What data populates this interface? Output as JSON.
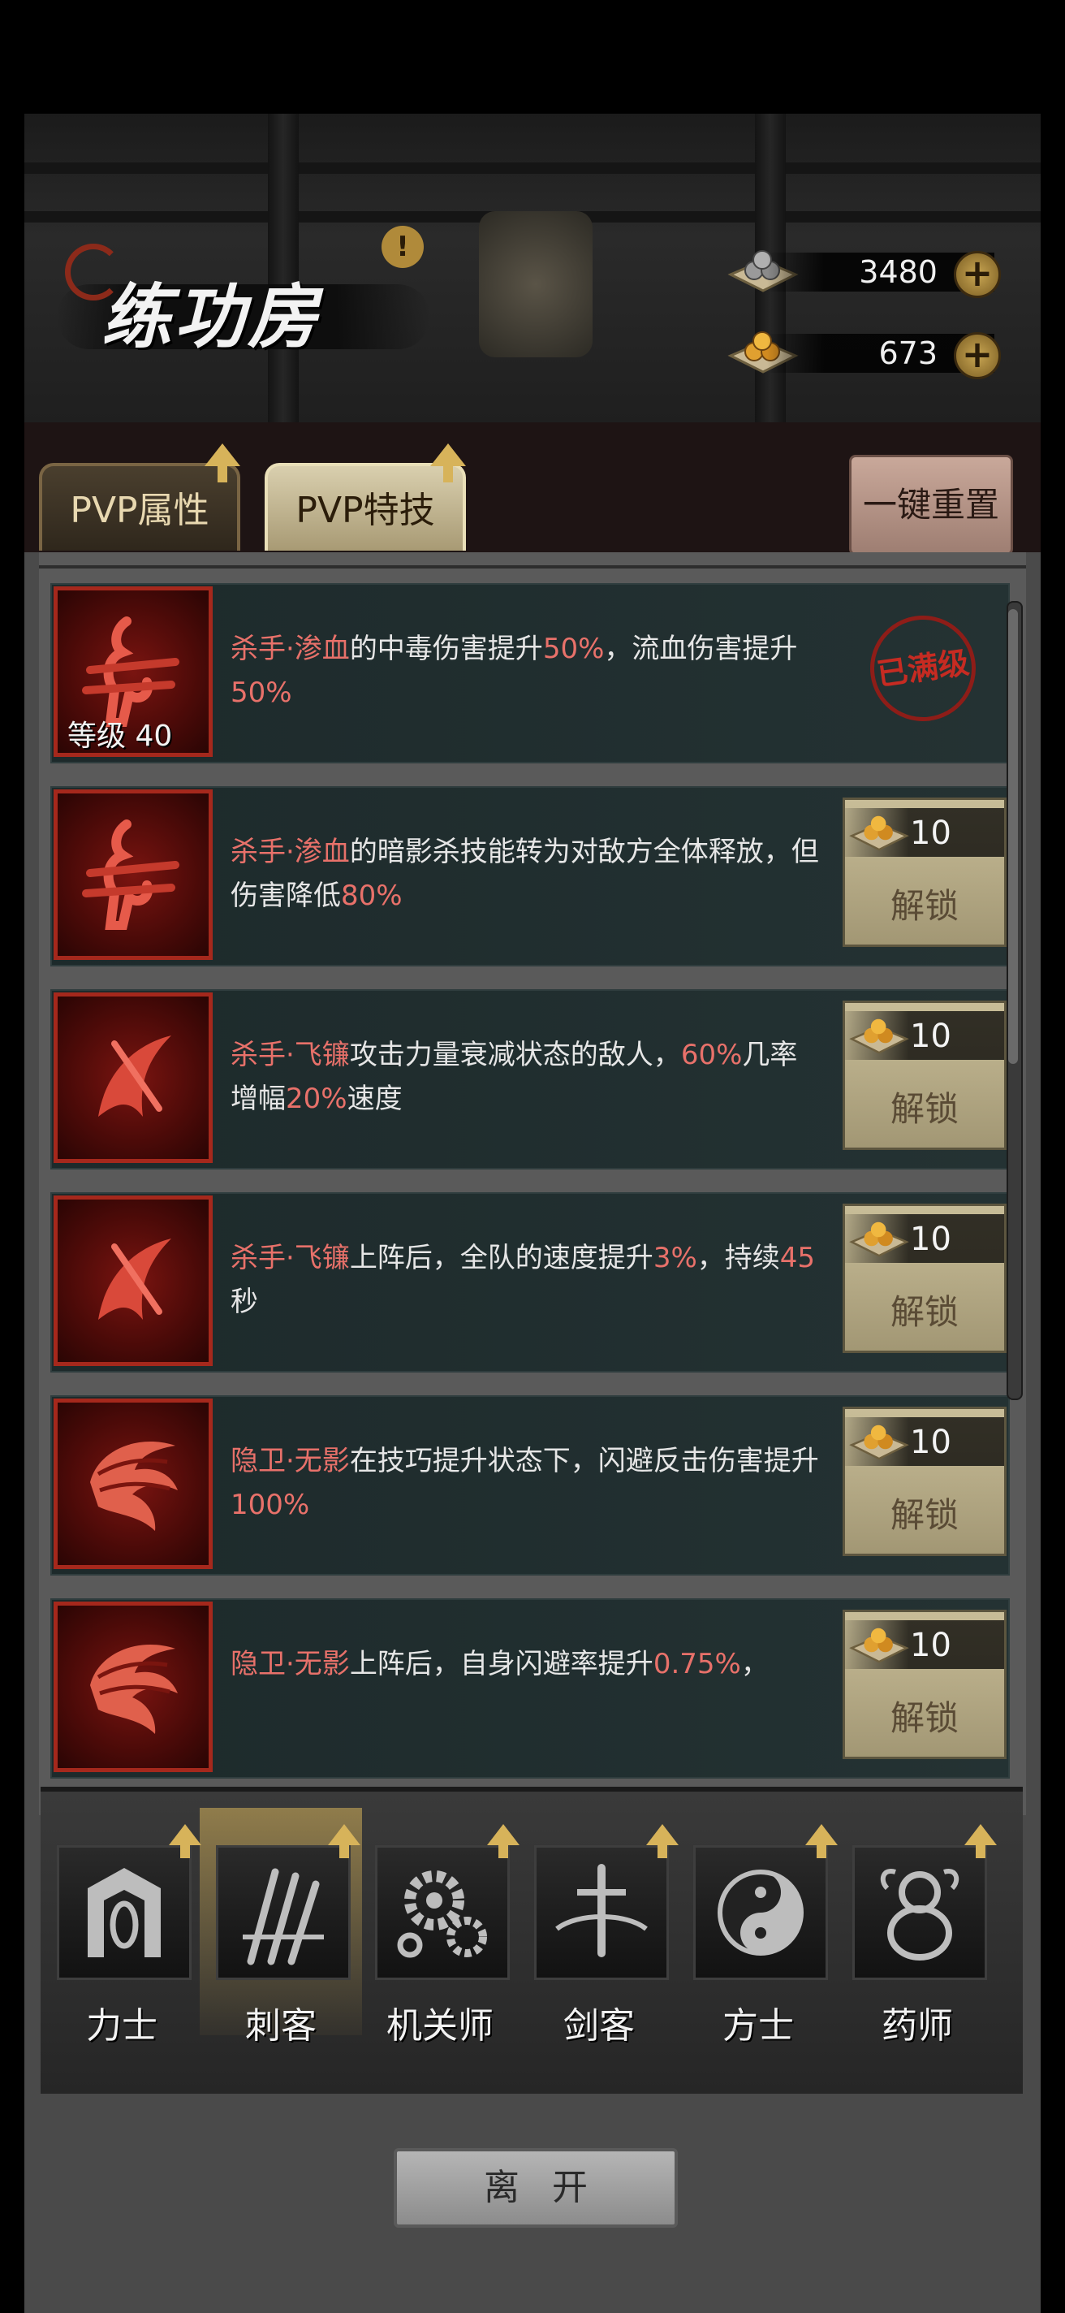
{
  "header": {
    "title": "练功房",
    "currencies": [
      {
        "name": "silver-ore",
        "value": "3480"
      },
      {
        "name": "gold-ore",
        "value": "673"
      }
    ]
  },
  "tabs": [
    {
      "label": "PVP属性",
      "active": false
    },
    {
      "label": "PVP特技",
      "active": true
    }
  ],
  "reset_label": "一键重置",
  "skills": [
    {
      "pre": "杀手·渗血",
      "t1": "的中毒伤害提升",
      "v1": "50%",
      "t2": "，流血伤害提升",
      "v2": "50%",
      "t3": "",
      "v3": "",
      "t4": "",
      "level_label": "等级 40",
      "status": "已满级",
      "emblem": "claw"
    },
    {
      "pre": "杀手·渗血",
      "t1": "的暗影杀技能转为对敌方全体释放，但伤害降低",
      "v1": "80%",
      "t2": "",
      "v2": "",
      "t3": "",
      "v3": "",
      "t4": "",
      "cost": "10",
      "action": "解锁",
      "emblem": "claw"
    },
    {
      "pre": "杀手·飞镰",
      "t1": "攻击力量衰减状态的敌人，",
      "v1": "60%",
      "t2": "几率增幅",
      "v2": "20%",
      "t3": "速度",
      "v3": "",
      "t4": "",
      "cost": "10",
      "action": "解锁",
      "emblem": "sickle"
    },
    {
      "pre": "杀手·飞镰",
      "t1": "上阵后，全队的速度提升",
      "v1": "3%",
      "t2": "，持续",
      "v2": "45",
      "t3": "秒",
      "v3": "",
      "t4": "",
      "cost": "10",
      "action": "解锁",
      "emblem": "sickle"
    },
    {
      "pre": "隐卫·无影",
      "t1": "在技巧提升状态下，闪避反击伤害提升",
      "v1": "100%",
      "t2": "",
      "v2": "",
      "t3": "",
      "v3": "",
      "t4": "",
      "cost": "10",
      "action": "解锁",
      "emblem": "bird"
    },
    {
      "pre": "隐卫·无影",
      "t1": "上阵后，自身闪避率提升",
      "v1": "0.75%",
      "t2": "，",
      "v2": "",
      "t3": "",
      "v3": "",
      "t4": "",
      "cost": "10",
      "action": "解锁",
      "emblem": "bird"
    }
  ],
  "classes": [
    {
      "label": "力士",
      "icon": "shield-icon",
      "selected": false
    },
    {
      "label": "刺客",
      "icon": "claw-icon",
      "selected": true
    },
    {
      "label": "机关师",
      "icon": "gears-icon",
      "selected": false
    },
    {
      "label": "剑客",
      "icon": "sword-icon",
      "selected": false
    },
    {
      "label": "方士",
      "icon": "yin-yang-icon",
      "selected": false
    },
    {
      "label": "药师",
      "icon": "gourd-icon",
      "selected": false
    }
  ],
  "leave_label": "离开",
  "colors": {
    "highlight": "#e8716a",
    "gold": "#d7b35a",
    "frame_red": "#a5281c"
  }
}
